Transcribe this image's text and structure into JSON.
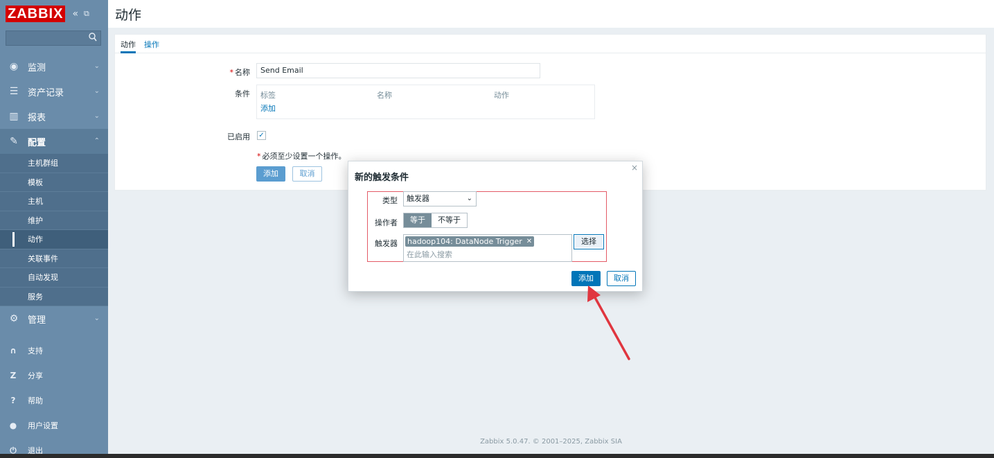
{
  "brand": {
    "logo": "ZABBIX",
    "collapse": "«",
    "kiosk": "⧉"
  },
  "search": {
    "placeholder": "",
    "value": ""
  },
  "sidebar": {
    "menu": [
      {
        "label": "监测",
        "icon": "eye-icon",
        "glyph": "◉",
        "caret": "⌄"
      },
      {
        "label": "资产记录",
        "icon": "list-icon",
        "glyph": "☰",
        "caret": "⌄"
      },
      {
        "label": "报表",
        "icon": "bar-chart-icon",
        "glyph": "▥",
        "caret": "⌄"
      },
      {
        "label": "配置",
        "icon": "wrench-icon",
        "glyph": "✎",
        "caret": "⌃"
      }
    ],
    "config_sub": [
      "主机群组",
      "模板",
      "主机",
      "维护",
      "动作",
      "关联事件",
      "自动发现",
      "服务"
    ],
    "admin": {
      "label": "管理",
      "icon": "gear-icon",
      "glyph": "⚙",
      "caret": "⌄"
    },
    "bottom": [
      {
        "label": "支持",
        "icon": "headset-icon",
        "glyph": "∩"
      },
      {
        "label": "分享",
        "icon": "share-icon",
        "glyph": "Z"
      },
      {
        "label": "帮助",
        "icon": "help-icon",
        "glyph": "?"
      },
      {
        "label": "用户设置",
        "icon": "user-icon",
        "glyph": "●"
      },
      {
        "label": "退出",
        "icon": "power-icon",
        "glyph": "⏻"
      }
    ]
  },
  "header": {
    "title": "动作"
  },
  "tabs": [
    "动作",
    "操作"
  ],
  "form": {
    "name_label": "名称",
    "name_value": "Send Email",
    "conditions_label": "条件",
    "cond_cols": [
      "标签",
      "名称",
      "动作"
    ],
    "cond_add": "添加",
    "enabled_label": "已启用",
    "enabled_check": "✓",
    "note": "必须至少设置一个操作。",
    "required_mark": "*",
    "add_btn": "添加",
    "cancel_btn": "取消"
  },
  "dialog": {
    "title": "新的触发条件",
    "close": "×",
    "type_label": "类型",
    "type_value": "触发器",
    "operator_label": "操作者",
    "op_equal": "等于",
    "op_not_equal": "不等于",
    "trigger_label": "触发器",
    "trigger_tag": "hadoop104: DataNode Trigger",
    "tag_remove": "✕",
    "trigger_placeholder": "在此输入搜索",
    "select_btn": "选择",
    "add_btn": "添加",
    "cancel_btn": "取消"
  },
  "footer": {
    "text": "Zabbix 5.0.47. © 2001–2025, Zabbix SIA"
  },
  "colors": {
    "sidebar": "#6a8caa",
    "primary": "#0275b8",
    "brand_red": "#d40000",
    "annotation_red": "#e0363f"
  }
}
